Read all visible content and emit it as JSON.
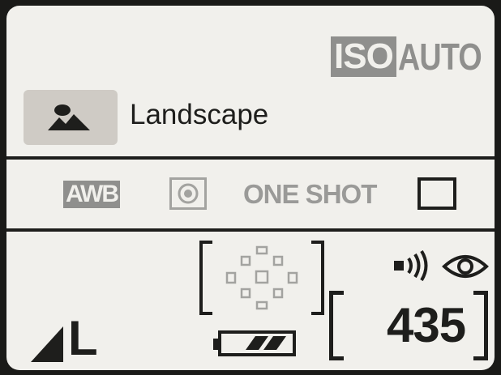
{
  "iso": {
    "badge": "ISO",
    "value": "AUTO"
  },
  "shooting_mode": {
    "icon": "landscape-mountain-icon",
    "label": "Landscape"
  },
  "white_balance": {
    "label": "AWB"
  },
  "metering": {
    "icon": "evaluative-metering-icon"
  },
  "af_mode": {
    "label": "ONE SHOT"
  },
  "drive_mode": {
    "icon": "single-shot-drive-icon"
  },
  "af_points": {
    "icon": "af-point-frame-icon"
  },
  "battery": {
    "icon": "battery-icon",
    "level": 0.66
  },
  "beep": {
    "icon": "beep-sound-icon"
  },
  "viewfinder": {
    "icon": "eye-sensor-icon"
  },
  "shots_remaining": "435",
  "image_quality": {
    "icon": "large-fine-quality-icon",
    "size": "L"
  },
  "colors": {
    "screen_bg": "#f1f0ec",
    "dark": "#1e1e1c",
    "grey": "#8f8f8d",
    "highlight": "#cfcbc5"
  }
}
